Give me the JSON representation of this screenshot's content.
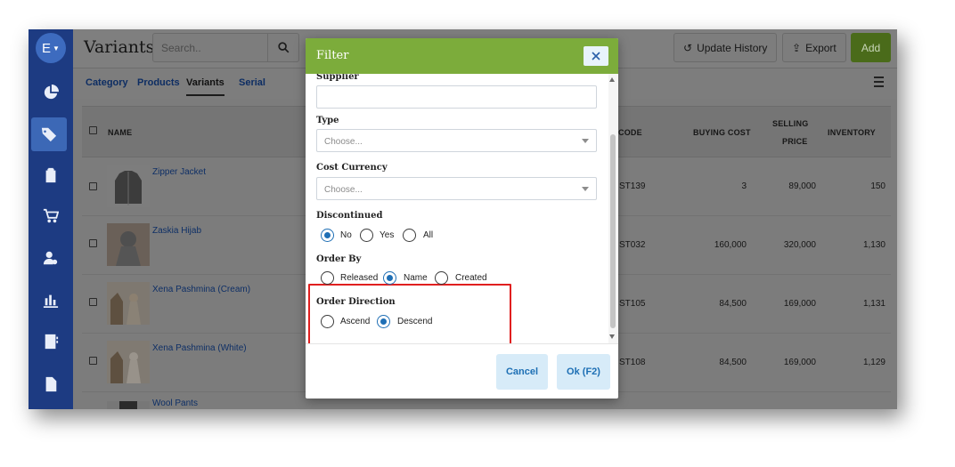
{
  "app": {
    "avatar_letter": "E",
    "page_title": "Variants",
    "search_placeholder": "Search..",
    "buttons": {
      "update_history": "Update History",
      "export": "Export",
      "add": "Add"
    },
    "brand_colors": {
      "sidebar": "#1d3b82",
      "header_green": "#7cac3b",
      "add_button": "#4a6b1a",
      "highlight": "#e01f1f"
    }
  },
  "sidebar": {
    "items": [
      {
        "icon": "pie-chart-icon"
      },
      {
        "icon": "tag-icon",
        "active": true
      },
      {
        "icon": "clipboard-icon"
      },
      {
        "icon": "cart-icon"
      },
      {
        "icon": "user-settings-icon"
      },
      {
        "icon": "bar-chart-icon"
      },
      {
        "icon": "contact-book-icon"
      },
      {
        "icon": "document-icon"
      }
    ]
  },
  "tabs": [
    "Category",
    "Products",
    "Variants",
    "Serial"
  ],
  "active_tab": "Variants",
  "table": {
    "headers": {
      "name": "NAME",
      "code": "CODE",
      "buying_cost": "BUYING COST",
      "selling_price_1": "SELLING",
      "selling_price_2": "PRICE",
      "inventory": "INVENTORY"
    },
    "rows": [
      {
        "name": "Zipper Jacket",
        "code": "ST139",
        "buying_cost": "3",
        "selling_price": "89,000",
        "inventory": "150"
      },
      {
        "name": "Zaskia Hijab",
        "code": "ST032",
        "buying_cost": "160,000",
        "selling_price": "320,000",
        "inventory": "1,130"
      },
      {
        "name": "Xena Pashmina (Cream)",
        "code": "ST105",
        "buying_cost": "84,500",
        "selling_price": "169,000",
        "inventory": "1,131"
      },
      {
        "name": "Xena Pashmina (White)",
        "code": "ST108",
        "buying_cost": "84,500",
        "selling_price": "169,000",
        "inventory": "1,129"
      },
      {
        "name": "Wool Pants"
      }
    ]
  },
  "dialog": {
    "title": "Filter",
    "supplier_label": "Supplier",
    "type_label": "Type",
    "type_placeholder": "Choose...",
    "cost_currency_label": "Cost Currency",
    "cost_currency_placeholder": "Choose...",
    "discontinued_label": "Discontinued",
    "discontinued_options": [
      "No",
      "Yes",
      "All"
    ],
    "discontinued_selected": "No",
    "order_by_label": "Order By",
    "order_by_options": [
      "Released",
      "Name",
      "Created"
    ],
    "order_by_selected": "Name",
    "order_direction_label": "Order Direction",
    "order_direction_options": [
      "Ascend",
      "Descend"
    ],
    "order_direction_selected": "Descend",
    "cancel_label": "Cancel",
    "ok_label": "Ok (F2)"
  }
}
